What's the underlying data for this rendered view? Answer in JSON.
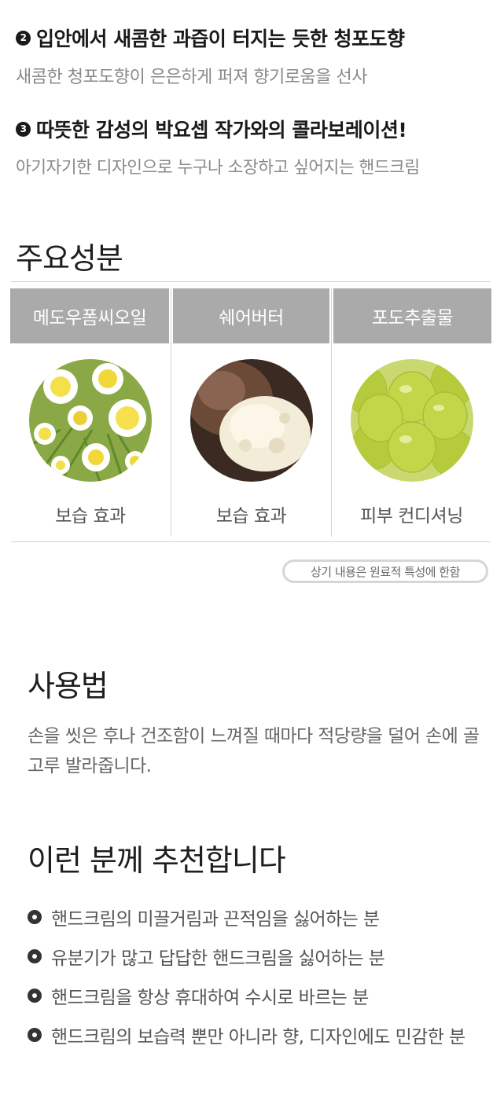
{
  "features": [
    {
      "num": "2",
      "title": "입안에서 새콤한 과즙이 터지는 듯한 청포도향",
      "desc": "새콤한 청포도향이 은은하게 퍼져 향기로움을 선사"
    },
    {
      "num": "3",
      "title": "따뜻한 감성의 박요셉 작가와의 콜라보레이션!",
      "desc": "아기자기한 디자인으로 누구나 소장하고 싶어지는 핸드크림"
    }
  ],
  "ingredients": {
    "title": "주요성분",
    "items": [
      {
        "name": "메도우폼씨오일",
        "effect": "보습 효과",
        "image": "meadowfoam-flower-icon"
      },
      {
        "name": "쉐어버터",
        "effect": "보습 효과",
        "image": "shea-butter-icon"
      },
      {
        "name": "포도추출물",
        "effect": "피부 컨디셔닝",
        "image": "green-grape-icon"
      }
    ],
    "note": "상기 내용은 원료적 특성에 한함"
  },
  "usage": {
    "title": "사용법",
    "text": "손을 씻은 후나 건조함이 느껴질 때마다 적당량을 덜어 손에 골고루 발라줍니다."
  },
  "recommend": {
    "title": "이런 분께 추천합니다",
    "items": [
      "핸드크림의 미끌거림과 끈적임을 싫어하는 분",
      "유분기가 많고 답답한 핸드크림을 싫어하는 분",
      "핸드크림을 항상 휴대하여 수시로 바르는 분",
      "핸드크림의 보습력 뿐만 아니라 향, 디자인에도 민감한 분"
    ]
  },
  "colors": {
    "header_bg": "#aaaaaa",
    "text_dark": "#1a1a1a",
    "text_gray": "#8a8a8a"
  }
}
